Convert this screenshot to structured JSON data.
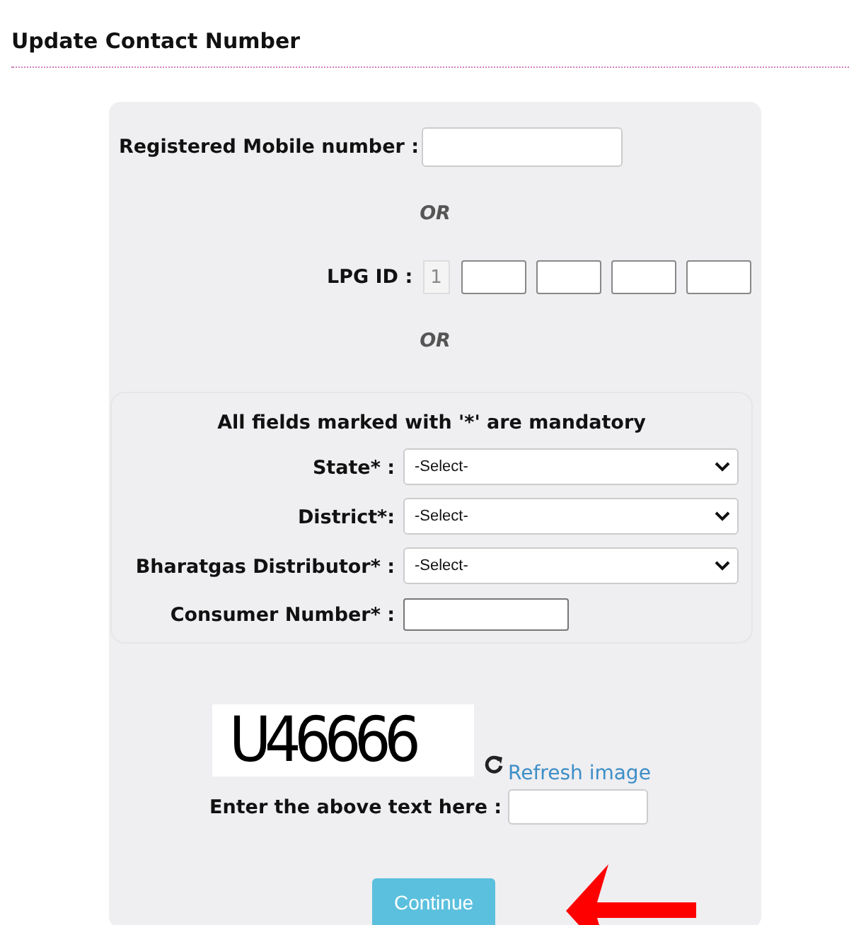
{
  "page": {
    "title": "Update Contact Number"
  },
  "mobile": {
    "label": "Registered Mobile number :"
  },
  "separators": [
    "OR",
    "OR"
  ],
  "lpg_id": {
    "label": "LPG ID :",
    "prefix": "1"
  },
  "mandatory": {
    "note": "All fields marked with '*' are mandatory",
    "fields": [
      {
        "kind": "select",
        "label": "State* :",
        "value": "-Select-"
      },
      {
        "kind": "select",
        "label": "District*:",
        "value": "-Select-"
      },
      {
        "kind": "select",
        "label": "Bharatgas Distributor* :",
        "value": "-Select-"
      },
      {
        "kind": "text",
        "label": "Consumer Number* :"
      }
    ]
  },
  "captcha": {
    "text": "U46666",
    "refresh": "Refresh image",
    "prompt": "Enter the above text here :"
  },
  "continue_button": "Continue"
}
